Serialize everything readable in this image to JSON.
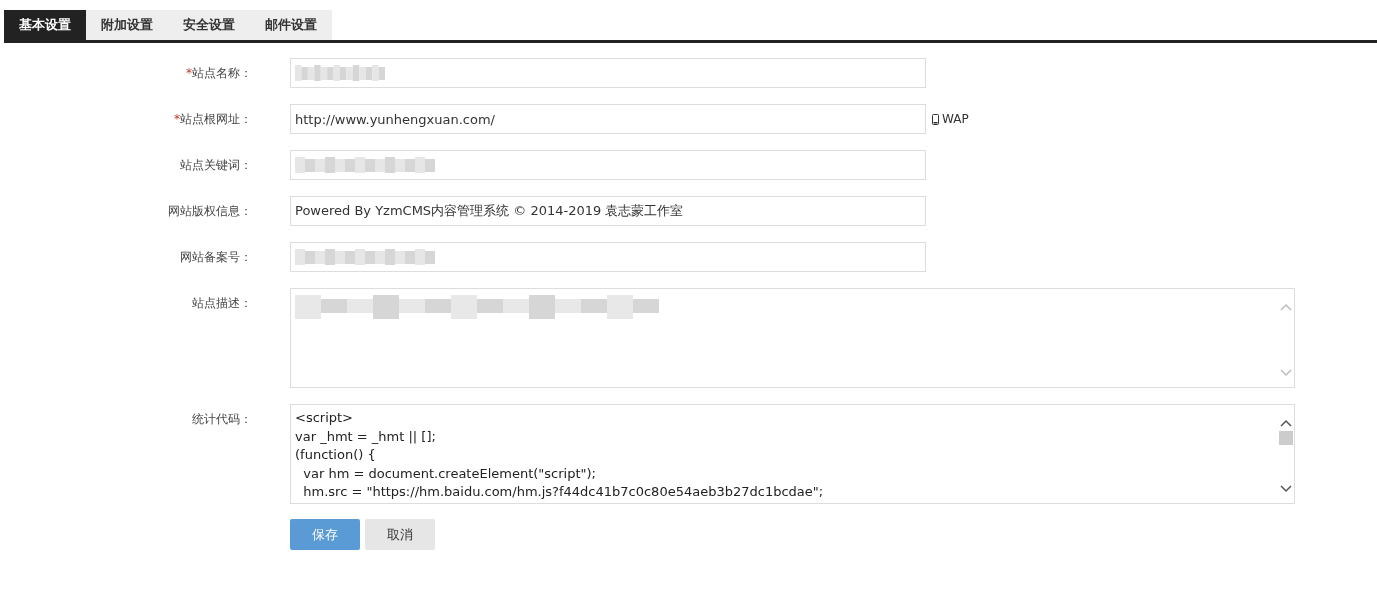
{
  "tabs": [
    {
      "label": "基本设置",
      "selected": true
    },
    {
      "label": "附加设置",
      "selected": false
    },
    {
      "label": "安全设置",
      "selected": false
    },
    {
      "label": "邮件设置",
      "selected": false
    }
  ],
  "fields": [
    {
      "kind": "input",
      "label": "站点名称：",
      "required_mark": "*",
      "redacted": true
    },
    {
      "kind": "input",
      "label": "站点根网址：",
      "required_mark": "*",
      "value": "http://www.yunhengxuan.com/",
      "suffix": "WAP"
    },
    {
      "kind": "input",
      "label": "站点关键词：",
      "redacted": true
    },
    {
      "kind": "input",
      "label": "网站版权信息：",
      "value": "Powered By YzmCMS内容管理系统 © 2014-2019 袁志蒙工作室"
    },
    {
      "kind": "input",
      "label": "网站备案号：",
      "redacted": true
    },
    {
      "kind": "textarea",
      "label": "站点描述：",
      "redacted": true
    },
    {
      "kind": "textarea",
      "label": "统计代码：",
      "value": "<script>\nvar _hmt = _hmt || [];\n(function() {\n  var hm = document.createElement(\"script\");\n  hm.src = \"https://hm.baidu.com/hm.js?f44dc41b7c0c80e54aeb3b27dc1bcdae\";",
      "scrolled": true
    }
  ],
  "buttons": [
    {
      "label": "保存",
      "kind": "primary"
    },
    {
      "label": "取消",
      "kind": "secondary"
    }
  ]
}
